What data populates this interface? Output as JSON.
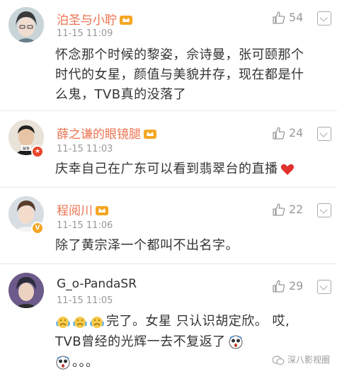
{
  "comments": [
    {
      "name": "泊圣与小聍",
      "time": "11-15 11:09",
      "likes": "54",
      "text_lines": [
        "怀念那个时候的黎姿，佘诗曼，张可颐那个",
        "时代的女星，颜值与美貌并存，现在都是什",
        "么鬼，TVB真的没落了"
      ]
    },
    {
      "name": "薛之谦的眼镜腿",
      "time": "11-15 11:03",
      "likes": "24",
      "text_lines": [
        "庆幸自己在广东可以看到翡翠台的直播"
      ]
    },
    {
      "name": "程阅川",
      "time": "11-15 11:06",
      "likes": "22",
      "text_lines": [
        "除了黄宗泽一个都叫不出名字。"
      ]
    },
    {
      "name": "G_o-PandaSR",
      "time": "11-15 11:05",
      "likes": "29",
      "text_lines": [
        "完了。女星 只认识胡定欣。 哎,",
        "TVB曾经的光辉一去不复返了",
        "。。。"
      ]
    }
  ],
  "watermark": "深八影视圈",
  "colors": {
    "name_orange": "#eb7350",
    "gray_text": "#999999",
    "heart_red": "#e0312d",
    "vip_gold": "#f5a623"
  }
}
